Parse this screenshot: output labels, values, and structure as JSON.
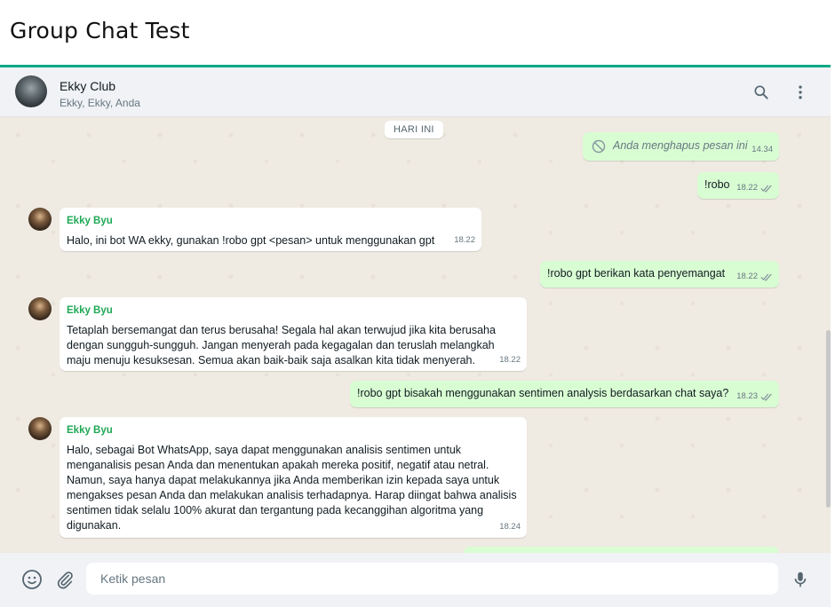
{
  "page": {
    "title": "Group Chat Test"
  },
  "header": {
    "chat_name": "Ekky Club",
    "members": "Ekky, Ekky, Anda"
  },
  "day_divider": "HARI INI",
  "messages": [
    {
      "type": "out",
      "text": "Anda menghapus pesan ini",
      "time": "14.34",
      "deleted": true
    },
    {
      "type": "out",
      "text": "!robo",
      "time": "18.22"
    },
    {
      "type": "in",
      "sender": "Ekky Byu",
      "text": "Halo, ini bot WA ekky, gunakan !robo gpt <pesan> untuk menggunakan gpt",
      "time": "18.22"
    },
    {
      "type": "out",
      "text": "!robo gpt berikan kata penyemangat",
      "time": "18.22"
    },
    {
      "type": "in",
      "sender": "Ekky Byu",
      "lines": [
        "Tetaplah bersemangat dan terus berusaha! Segala hal akan terwujud jika kita berusaha",
        "dengan sungguh-sungguh. Jangan menyerah pada kegagalan dan teruslah melangkah",
        "maju menuju kesuksesan. Semua akan baik-baik saja asalkan kita tidak menyerah."
      ],
      "time": "18.22"
    },
    {
      "type": "out",
      "text": "!robo gpt bisakah menggunakan sentimen analysis berdasarkan chat saya?",
      "time": "18.23"
    },
    {
      "type": "in",
      "sender": "Ekky Byu",
      "lines": [
        "Halo, sebagai Bot WhatsApp, saya dapat menggunakan analisis sentimen untuk",
        "menganalisis pesan Anda dan menentukan apakah mereka positif, negatif atau netral.",
        "Namun, saya hanya dapat melakukannya jika Anda memberikan izin kepada saya untuk",
        "mengakses pesan Anda dan melakukan analisis terhadapnya. Harap diingat bahwa analisis",
        "sentimen tidak selalu 100% akurat dan tergantung pada kecanggihan algoritma yang",
        "digunakan."
      ],
      "time": "18.24"
    }
  ],
  "composer": {
    "placeholder": "Ketik pesan"
  },
  "colors": {
    "accent": "#00a884",
    "outgoing_bubble": "#d9fdd3",
    "incoming_bubble": "#ffffff",
    "sender_name": "#1fa855",
    "read_tick": "#53bdeb"
  },
  "icons": [
    "search-icon",
    "menu-dots-icon",
    "emoji-icon",
    "attach-icon",
    "mic-icon",
    "chevron-down-icon",
    "blocked-icon",
    "double-check-icon"
  ]
}
